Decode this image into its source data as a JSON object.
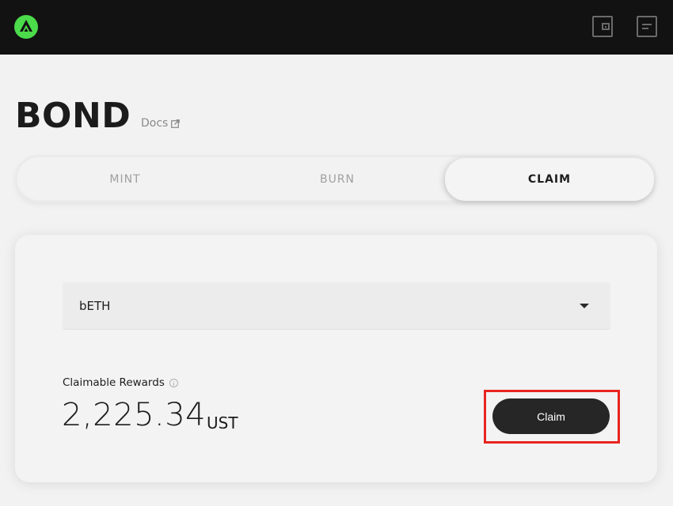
{
  "header": {
    "logo_icon": "anchor-logo-icon",
    "wallet_icon": "wallet-icon",
    "menu_icon": "menu-icon",
    "logo_color": "#4bdb4b"
  },
  "page": {
    "title": "BOND",
    "docs_label": "Docs",
    "docs_icon": "external-link-icon"
  },
  "tabs": [
    {
      "label": "MINT"
    },
    {
      "label": "BURN"
    },
    {
      "label": "CLAIM",
      "active": true
    }
  ],
  "claim": {
    "selected_asset": "bETH",
    "rewards_label": "Claimable Rewards",
    "rewards_amount": "2,225.34",
    "rewards_unit": "UST",
    "claim_button_label": "Claim",
    "highlight_color": "#e8241f"
  }
}
